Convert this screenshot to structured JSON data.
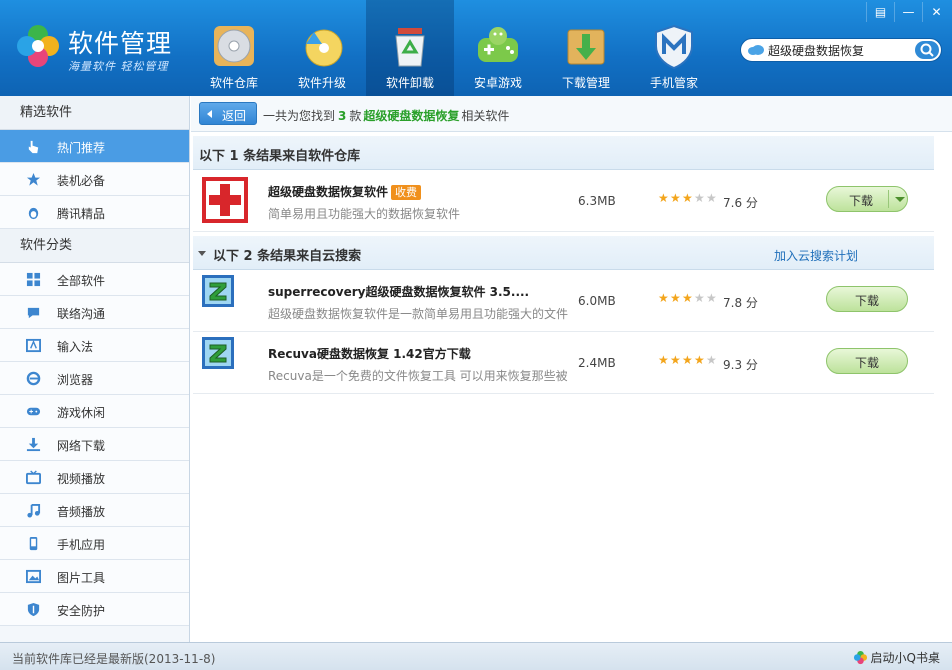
{
  "app": {
    "title": "软件管理",
    "slogan": "海量软件 轻松管理"
  },
  "window_buttons": [
    {
      "name": "menu",
      "glyph": "▤"
    },
    {
      "name": "minimize",
      "glyph": "—"
    },
    {
      "name": "close",
      "glyph": "✕"
    }
  ],
  "nav": [
    {
      "label": "软件仓库",
      "icon": "disc-icon"
    },
    {
      "label": "软件升级",
      "icon": "upgrade-disc-icon"
    },
    {
      "label": "软件卸载",
      "icon": "recycle-bin-icon"
    },
    {
      "label": "安卓游戏",
      "icon": "android-gamepad-icon"
    },
    {
      "label": "下载管理",
      "icon": "download-box-icon"
    },
    {
      "label": "手机管家",
      "icon": "shield-m-icon"
    }
  ],
  "search": {
    "value": "超级硬盘数据恢复"
  },
  "sidebar": {
    "section1": "精选软件",
    "items1": [
      {
        "label": "热门推荐",
        "icon": "hand-pointer-icon"
      },
      {
        "label": "装机必备",
        "icon": "star-icon"
      },
      {
        "label": "腾讯精品",
        "icon": "penguin-icon"
      }
    ],
    "section2": "软件分类",
    "items2": [
      {
        "label": "全部软件",
        "icon": "grid-icon"
      },
      {
        "label": "联络沟通",
        "icon": "chat-icon"
      },
      {
        "label": "输入法",
        "icon": "keyboard-icon"
      },
      {
        "label": "浏览器",
        "icon": "browser-e-icon"
      },
      {
        "label": "游戏休闲",
        "icon": "gamepad-icon"
      },
      {
        "label": "网络下载",
        "icon": "download-icon"
      },
      {
        "label": "视频播放",
        "icon": "tv-icon"
      },
      {
        "label": "音频播放",
        "icon": "music-note-icon"
      },
      {
        "label": "手机应用",
        "icon": "phone-icon"
      },
      {
        "label": "图片工具",
        "icon": "image-icon"
      },
      {
        "label": "安全防护",
        "icon": "shield-icon"
      }
    ]
  },
  "topbar": {
    "back_label": "返回",
    "prefix": "一共为您找到",
    "count": "3",
    "unit": "款",
    "keyword": "超级硬盘数据恢复",
    "suffix": "相关软件"
  },
  "group1": {
    "title": "以下 1 条结果来自软件仓库"
  },
  "group2": {
    "title": "以下 2 条结果来自云搜索",
    "link": "加入云搜索计划"
  },
  "results": [
    {
      "title": "超级硬盘数据恢复软件",
      "badge": "收费",
      "desc": "简单易用且功能强大的数据恢复软件",
      "size": "6.3MB",
      "rating": 3,
      "score": "7.6 分",
      "download": "下载",
      "icon": "red-cross-icon"
    },
    {
      "title": "superrecovery超级硬盘数据恢复软件 3.5....",
      "desc": "超级硬盘数据恢复软件是一款简单易用且功能强大的文件",
      "size": "6.0MB",
      "rating": 3,
      "score": "7.8 分",
      "download": "下载",
      "icon": "z-app-icon"
    },
    {
      "title": "Recuva硬盘数据恢复 1.42官方下载",
      "desc": "Recuva是一个免费的文件恢复工具 可以用来恢复那些被",
      "size": "2.4MB",
      "rating": 4,
      "score": "9.3 分",
      "download": "下载",
      "icon": "z-app-icon"
    }
  ],
  "footer": {
    "status": "当前软件库已经是最新版(2013-11-8)",
    "right": "启动小Q书桌"
  }
}
